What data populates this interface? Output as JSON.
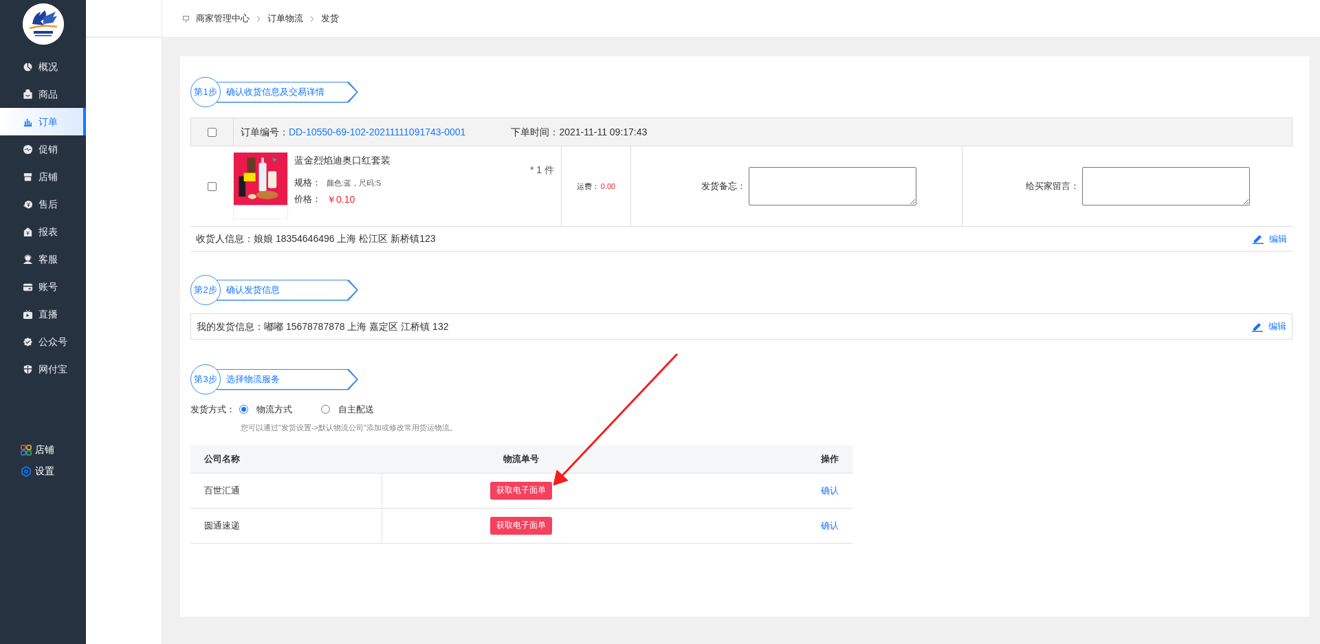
{
  "sidebar": {
    "items": [
      {
        "label": "概况",
        "selected": false
      },
      {
        "label": "商品",
        "selected": false
      },
      {
        "label": "订单",
        "selected": true
      },
      {
        "label": "促销",
        "selected": false
      },
      {
        "label": "店铺",
        "selected": false
      },
      {
        "label": "售后",
        "selected": false
      },
      {
        "label": "报表",
        "selected": false
      },
      {
        "label": "客服",
        "selected": false
      },
      {
        "label": "账号",
        "selected": false
      },
      {
        "label": "直播",
        "selected": false
      },
      {
        "label": "公众号",
        "selected": false
      },
      {
        "label": "网付宝",
        "selected": false
      }
    ],
    "footer": [
      {
        "label": "店铺"
      },
      {
        "label": "设置"
      }
    ]
  },
  "breadcrumb": [
    "商家管理中心",
    "订单物流",
    "发货"
  ],
  "steps": [
    {
      "badge": "第1步",
      "title": "确认收货信息及交易详情"
    },
    {
      "badge": "第2步",
      "title": "确认发货信息"
    },
    {
      "badge": "第3步",
      "title": "选择物流服务"
    }
  ],
  "order": {
    "checked": false,
    "number_label": "订单编号：",
    "number": "DD-10550-69-102-20211111091743-0001",
    "time_label": "下单时间：",
    "time": "2021-11-11 09:17:43",
    "item": {
      "checked": false,
      "name": "蓝金烈焰迪奥口红套装",
      "spec_label": "规格：",
      "spec": "颜色:蓝，尺码:S",
      "price_label": "价格：",
      "price": "￥0.10",
      "quantity": "* 1 件",
      "freight_label": "运费：",
      "freight": "0.00"
    },
    "note_label": "发货备忘：",
    "message_label": "给买家留言：",
    "receiver": "收货人信息：娘娘 18354646496  上海 松江区 新桥镇123",
    "edit": "编辑"
  },
  "sender": {
    "text": "我的发货信息：嘟嘟 15678787878 上海 嘉定区 江桥镇 132",
    "edit": "编辑"
  },
  "shipping": {
    "label": "发货方式：",
    "options": [
      {
        "label": "物流方式",
        "selected": true
      },
      {
        "label": "自主配送",
        "selected": false
      }
    ],
    "hint": "您可以通过\"发货设置->默认物流公司\"添加或修改常用货运物流。"
  },
  "carriers": {
    "columns": [
      "公司名称",
      "物流单号",
      "操作"
    ],
    "rows": [
      {
        "name": "百世汇通",
        "button": "获取电子面单",
        "action": "确认"
      },
      {
        "name": "圆通速递",
        "button": "获取电子面单",
        "action": "确认"
      }
    ]
  }
}
